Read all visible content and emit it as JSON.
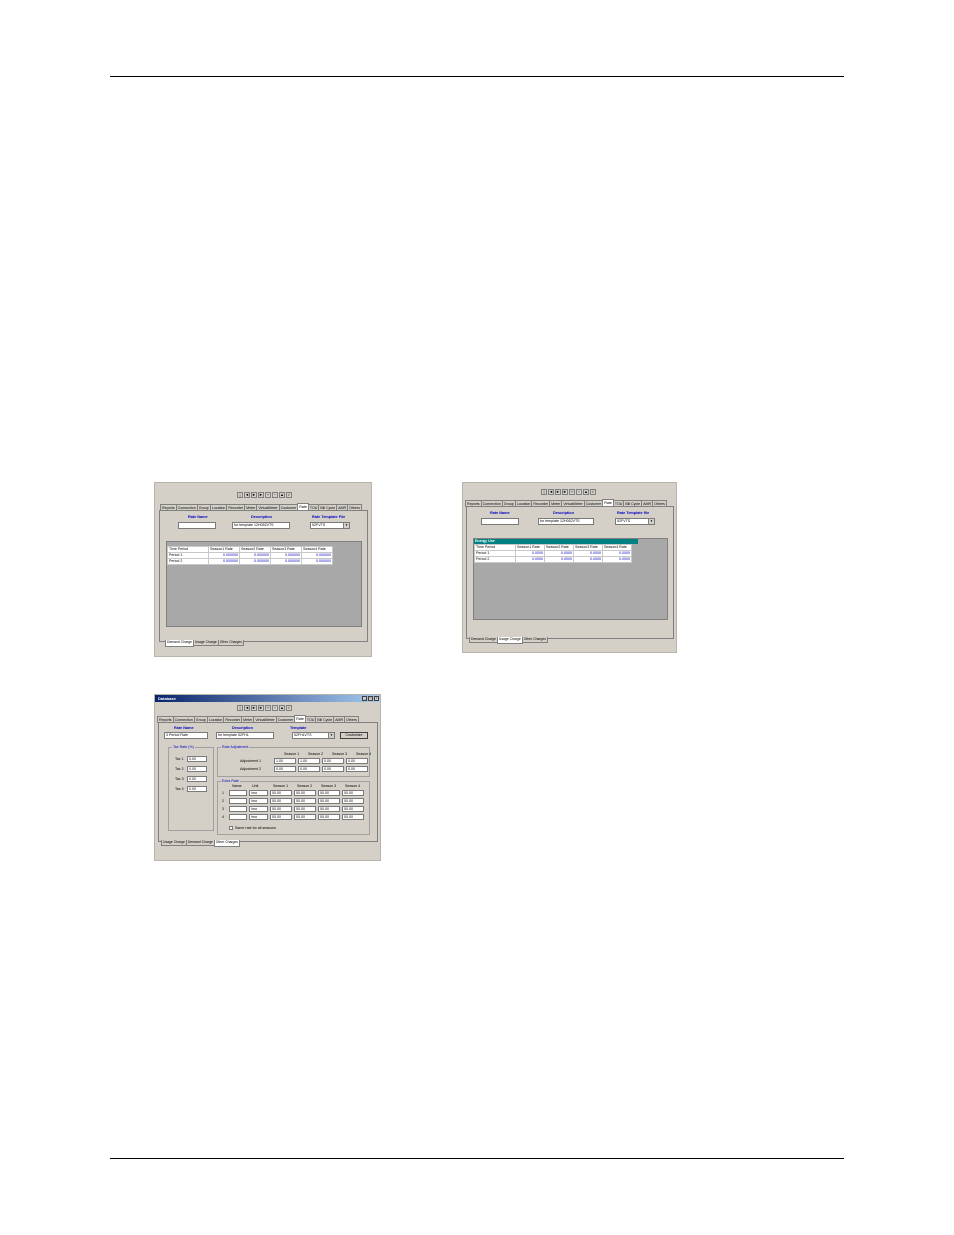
{
  "nav_buttons": [
    "|◄",
    "◄",
    "►",
    "►|",
    "+",
    "−",
    "▲",
    "✓"
  ],
  "tabs_s1": [
    "Reports",
    "Connection",
    "Group",
    "Location",
    "Recorder",
    "Meter",
    "VirtualMeter",
    "Customer",
    "Rate",
    "TOU",
    "Bill Cycle",
    "AMR",
    "Others"
  ],
  "tabs_s3": [
    "Reports",
    "Connection",
    "Group",
    "Location",
    "Recorder",
    "Meter",
    "VirtualMeter",
    "Customer",
    "Rate",
    "TOU",
    "Bill Cycle",
    "AMR",
    "Others"
  ],
  "active_tab": "Rate",
  "shot1": {
    "rate_name_label": "Rate Name",
    "rate_name_value": "",
    "description_label": "Description",
    "description_value": "for template 12H052VTS",
    "template_label": "Rate Template File",
    "template_value": "52FVTS",
    "columns": [
      "Time Period",
      "Season1 Rate",
      "Season2 Rate",
      "Season3 Rate",
      "Season4 Rate"
    ],
    "rows": [
      [
        "Period 1",
        "0.000000",
        "0.000000",
        "0.000000",
        "0.000000"
      ],
      [
        "Period 2",
        "0.000000",
        "0.000000",
        "0.000000",
        "0.000000"
      ]
    ],
    "bottom_tabs": [
      "Demand Charge",
      "Usage Charge",
      "Other Charges"
    ],
    "active_bottom_tab": "Demand Charge"
  },
  "shot2": {
    "rate_name_label": "Rate Name",
    "rate_name_value": "",
    "description_label": "Description",
    "description_value": "for template 12H052VTS",
    "template_label": "Rate Template file",
    "template_value": "52FVTS",
    "grid_title": "Energy Use",
    "columns": [
      "Time Period",
      "Season1 Rate",
      "Season2 Rate",
      "Season3 Rate",
      "Season4 Rate"
    ],
    "rows": [
      [
        "Period 1",
        "0.0000",
        "0.0000",
        "0.0000",
        "0.0000"
      ],
      [
        "Period 2",
        "0.0000",
        "0.0000",
        "0.0000",
        "0.0000"
      ]
    ],
    "bottom_tabs": [
      "Demand Charge",
      "Usage Charge",
      "Other Charges"
    ],
    "active_bottom_tab": "Usage Charge"
  },
  "shot3": {
    "window_title": "Database",
    "rate_name_label": "Rate Name",
    "rate_name_value": "3 Period Rate",
    "description_label": "Description",
    "description_value": "for template 52FHL",
    "template_label": "Template",
    "template_value": "52FHLVTS",
    "customize_label": "Customize",
    "tax_legend": "Tax Rate (%)",
    "tax_rows": [
      {
        "label": "Tax 1",
        "value": "0.00"
      },
      {
        "label": "Tax 2",
        "value": "0.00"
      },
      {
        "label": "Tax 3",
        "value": "0.00"
      },
      {
        "label": "Tax 4",
        "value": "0.00"
      }
    ],
    "adj_legend": "Rate Adjustment",
    "adj_columns": [
      "Season 1",
      "Season 2",
      "Season 3",
      "Season 4"
    ],
    "adj_rows": [
      {
        "label": "Adjustment 1",
        "values": [
          "1.00",
          "1.00",
          "0.00",
          "0.00"
        ]
      },
      {
        "label": "Adjustment 2",
        "values": [
          "0.00",
          "0.00",
          "0.00",
          "0.00"
        ]
      }
    ],
    "extra_legend": "Extra Rate",
    "extra_columns": [
      "Name",
      "Unit",
      "Season 1",
      "Season 2",
      "Season 3",
      "Season 4"
    ],
    "extra_rows": [
      {
        "num": "1",
        "name": "",
        "unit": "/mo",
        "values": [
          "00.00",
          "00.00",
          "00.00",
          "00.00"
        ]
      },
      {
        "num": "2",
        "name": "",
        "unit": "/mo",
        "values": [
          "00.00",
          "00.00",
          "00.00",
          "00.00"
        ]
      },
      {
        "num": "3",
        "name": "",
        "unit": "/mo",
        "values": [
          "00.00",
          "00.00",
          "00.00",
          "00.00"
        ]
      },
      {
        "num": "4",
        "name": "",
        "unit": "/mo",
        "values": [
          "00.00",
          "00.00",
          "00.00",
          "00.00"
        ]
      }
    ],
    "same_rate_label": "Same rate for all seasons",
    "bottom_tabs": [
      "Usage Charge",
      "Demand Charge",
      "Other Charges"
    ],
    "active_bottom_tab": "Other Charges"
  }
}
